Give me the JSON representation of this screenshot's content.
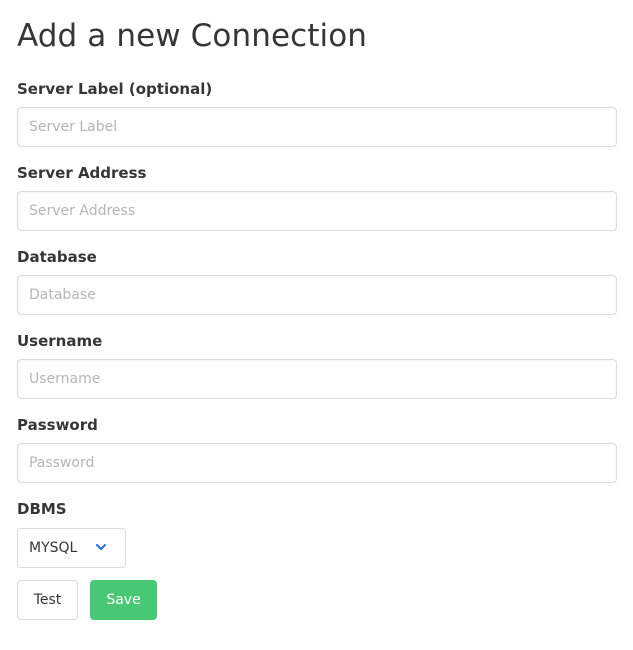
{
  "page": {
    "title": "Add a new Connection"
  },
  "form": {
    "fields": [
      {
        "label": "Server Label (optional)",
        "placeholder": "Server Label",
        "value": ""
      },
      {
        "label": "Server Address",
        "placeholder": "Server Address",
        "value": ""
      },
      {
        "label": "Database",
        "placeholder": "Database",
        "value": ""
      },
      {
        "label": "Username",
        "placeholder": "Username",
        "value": ""
      },
      {
        "label": "Password",
        "placeholder": "Password",
        "value": ""
      }
    ],
    "dbms": {
      "label": "DBMS",
      "selected": "MYSQL",
      "icon": "chevron-down-icon"
    },
    "buttons": {
      "test": "Test",
      "save": "Save"
    }
  },
  "colors": {
    "primary_green": "#48c774",
    "chevron_blue": "#3273dc",
    "border": "#dbdbdb",
    "text": "#363636",
    "placeholder": "#b5b5b5"
  }
}
